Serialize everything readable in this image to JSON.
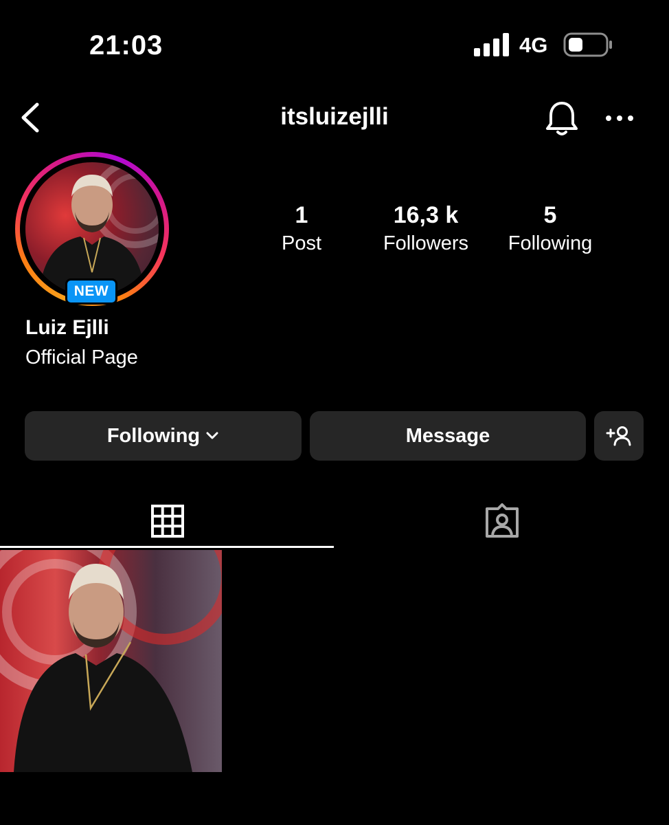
{
  "status_bar": {
    "time": "21:03",
    "network": "4G"
  },
  "header": {
    "username": "itsluizejlli"
  },
  "profile": {
    "badge": "NEW",
    "name": "Luiz Ejlli",
    "bio": "Official Page",
    "ring_colors": [
      "#f9a11b",
      "#fd7e14",
      "#f5345c",
      "#d3178c",
      "#b10ad4"
    ]
  },
  "stats": [
    {
      "value": "1",
      "label": "Post"
    },
    {
      "value": "16,3 k",
      "label": "Followers"
    },
    {
      "value": "5",
      "label": "Following"
    }
  ],
  "actions": {
    "following_label": "Following",
    "message_label": "Message"
  },
  "tabs": [
    {
      "icon": "grid-icon",
      "selected": true
    },
    {
      "icon": "tagged-person-icon",
      "selected": false
    }
  ],
  "colors": {
    "background": "#000000",
    "button_bg": "#262626",
    "badge_blue": "#0a95f6"
  }
}
